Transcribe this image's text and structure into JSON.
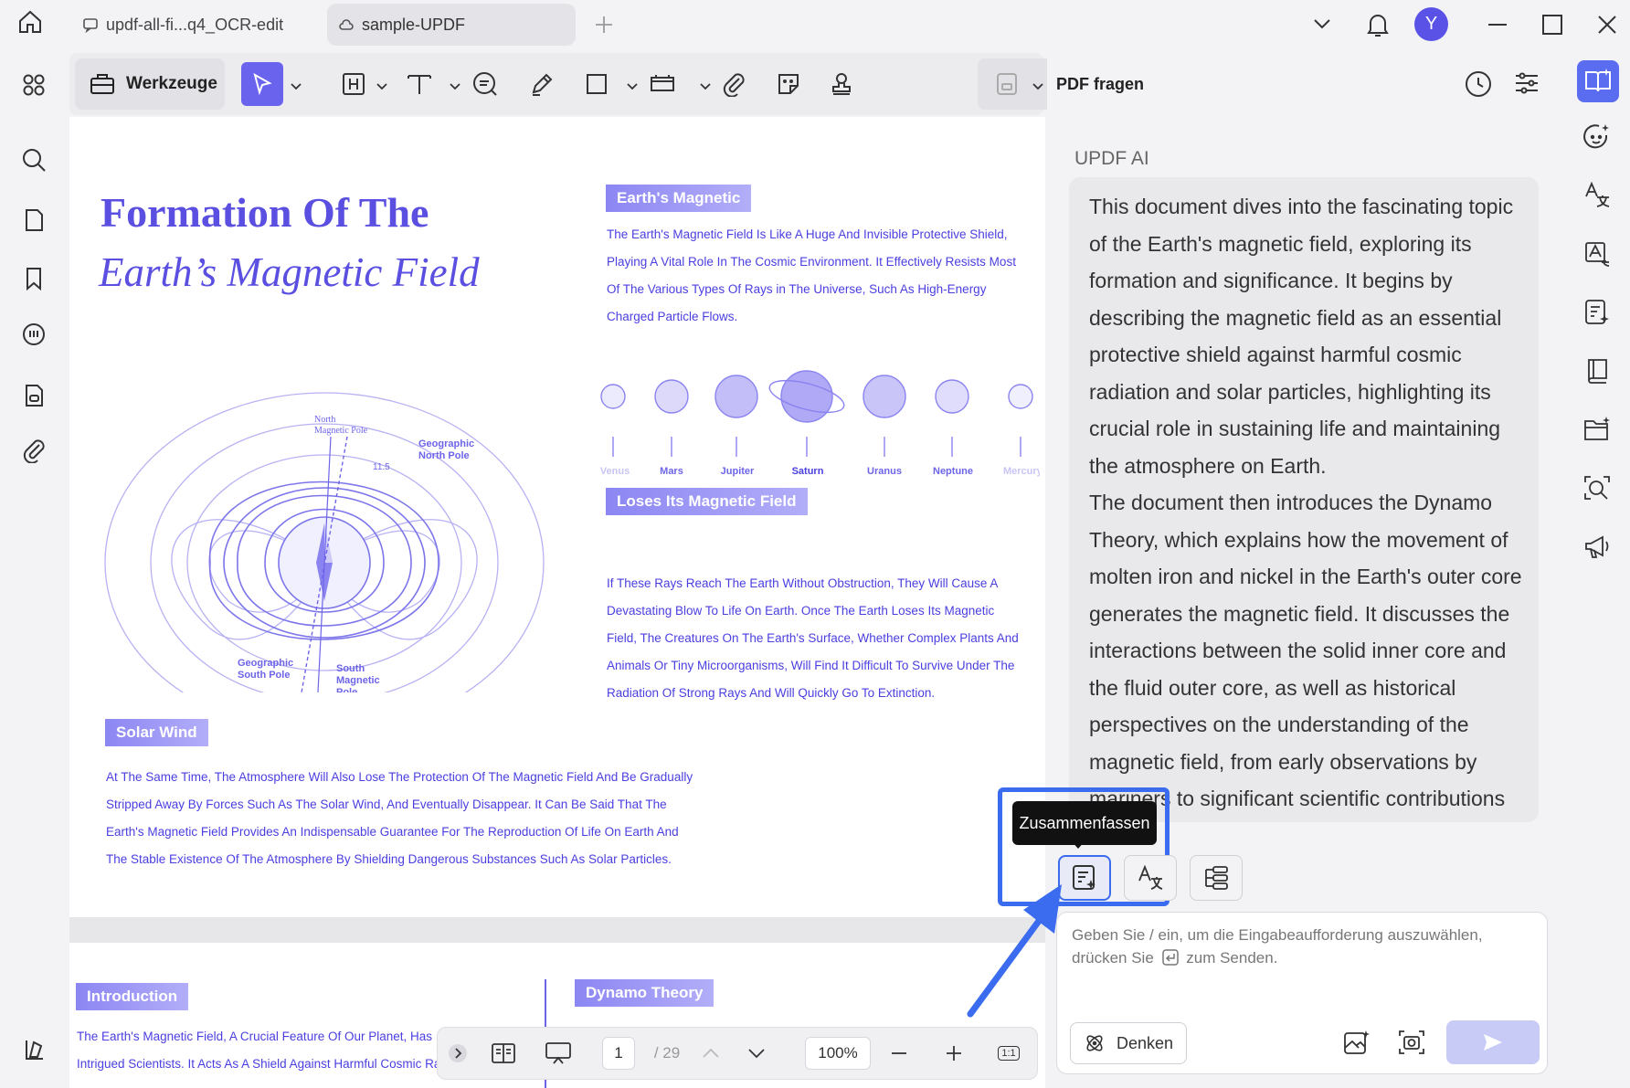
{
  "titlebar": {
    "tabs": [
      {
        "label": "updf-all-fi...q4_OCR-edit"
      },
      {
        "label": "sample-UPDF"
      }
    ],
    "avatar_initial": "Y"
  },
  "toolbar": {
    "tools_label": "Werkzeuge"
  },
  "document": {
    "title_line1": "Formation Of The",
    "title_line2": "Earth’s Magnetic Field",
    "diagram_labels": {
      "north_magnetic": "North\nMagnetic Pole",
      "geo_north": "Geographic\nNorth Pole",
      "angle": "11.5",
      "geo_south": "Geographic\nSouth Pole",
      "south_magnetic": "South\nMagnetic\nPole"
    },
    "sections": [
      {
        "title": "Earth's Magnetic",
        "lines": [
          "The Earth's Magnetic Field Is Like A Huge And Invisible Protective Shield,",
          "Playing A Vital Role In The Cosmic Environment. It Effectively Resists Most",
          "Of The Various Types Of Rays in The Universe, Such As High-Energy",
          "Charged Particle Flows."
        ]
      },
      {
        "title": "Loses Its Magnetic Field",
        "lines": [
          "If These Rays Reach The Earth Without Obstruction, They Will Cause A",
          "Devastating Blow To Life On Earth. Once The Earth Loses Its Magnetic",
          "Field, The Creatures On The Earth's Surface, Whether Complex Plants And",
          "Animals Or Tiny Microorganisms, Will Find It Difficult To Survive Under The",
          "Radiation Of Strong Rays And Will Quickly Go To Extinction."
        ]
      },
      {
        "title": "Solar Wind",
        "lines": [
          "At The Same Time, The Atmosphere Will Also Lose The Protection Of The Magnetic Field And Be Gradually",
          "Stripped Away By Forces Such As The Solar Wind, And Eventually Disappear. It Can Be Said That The",
          "Earth's Magnetic Field Provides An Indispensable Guarantee For The Reproduction Of Life On Earth And",
          "The Stable Existence Of The Atmosphere By Shielding Dangerous Substances Such As Solar Particles."
        ]
      }
    ],
    "planets": [
      "Venus",
      "Mars",
      "Jupiter",
      "Saturn",
      "Uranus",
      "Neptune",
      "Mercury"
    ],
    "page2": {
      "intro_title": "Introduction",
      "dynamo_title": "Dynamo Theory",
      "intro_lines": [
        "The Earth's Magnetic Field, A Crucial Feature Of Our Planet, Has",
        "Intrigued Scientists. It Acts As A Shield Against Harmful Cosmic Radiation"
      ]
    }
  },
  "bottomnav": {
    "current_page": "1",
    "total_pages": "/ 29",
    "zoom": "100%",
    "actual_size": "1:1"
  },
  "ai_panel": {
    "header": "PDF fragen",
    "assistant_name": "UPDF AI",
    "response": "This document dives into the fascinating topic of the Earth's magnetic field, exploring its formation and significance. It begins by describing the magnetic field as an essential protective shield against harmful cosmic radiation and solar particles, highlighting its crucial role in sustaining life and maintaining the atmosphere on Earth.\nThe document then introduces the Dynamo Theory, which explains how the movement of molten iron and nickel in the Earth's outer core generates the magnetic field. It discusses the interactions between the solid inner core and the fluid outer core, as well as historical perspectives on the understanding of the magnetic field, from early observations by mariners to significant scientific contributions",
    "tooltip": "Zusammenfassen",
    "prompt_placeholder_line1": "Geben Sie / ein, um die Eingabeaufforderung auszuwählen,",
    "prompt_placeholder_line2_pre": "drücken Sie",
    "prompt_placeholder_line2_post": "zum Senden.",
    "think_label": "Denken"
  },
  "colors": {
    "accent": "#5a4fe0",
    "highlight": "#3b6cf0",
    "select_tool": "#6a63ee"
  }
}
